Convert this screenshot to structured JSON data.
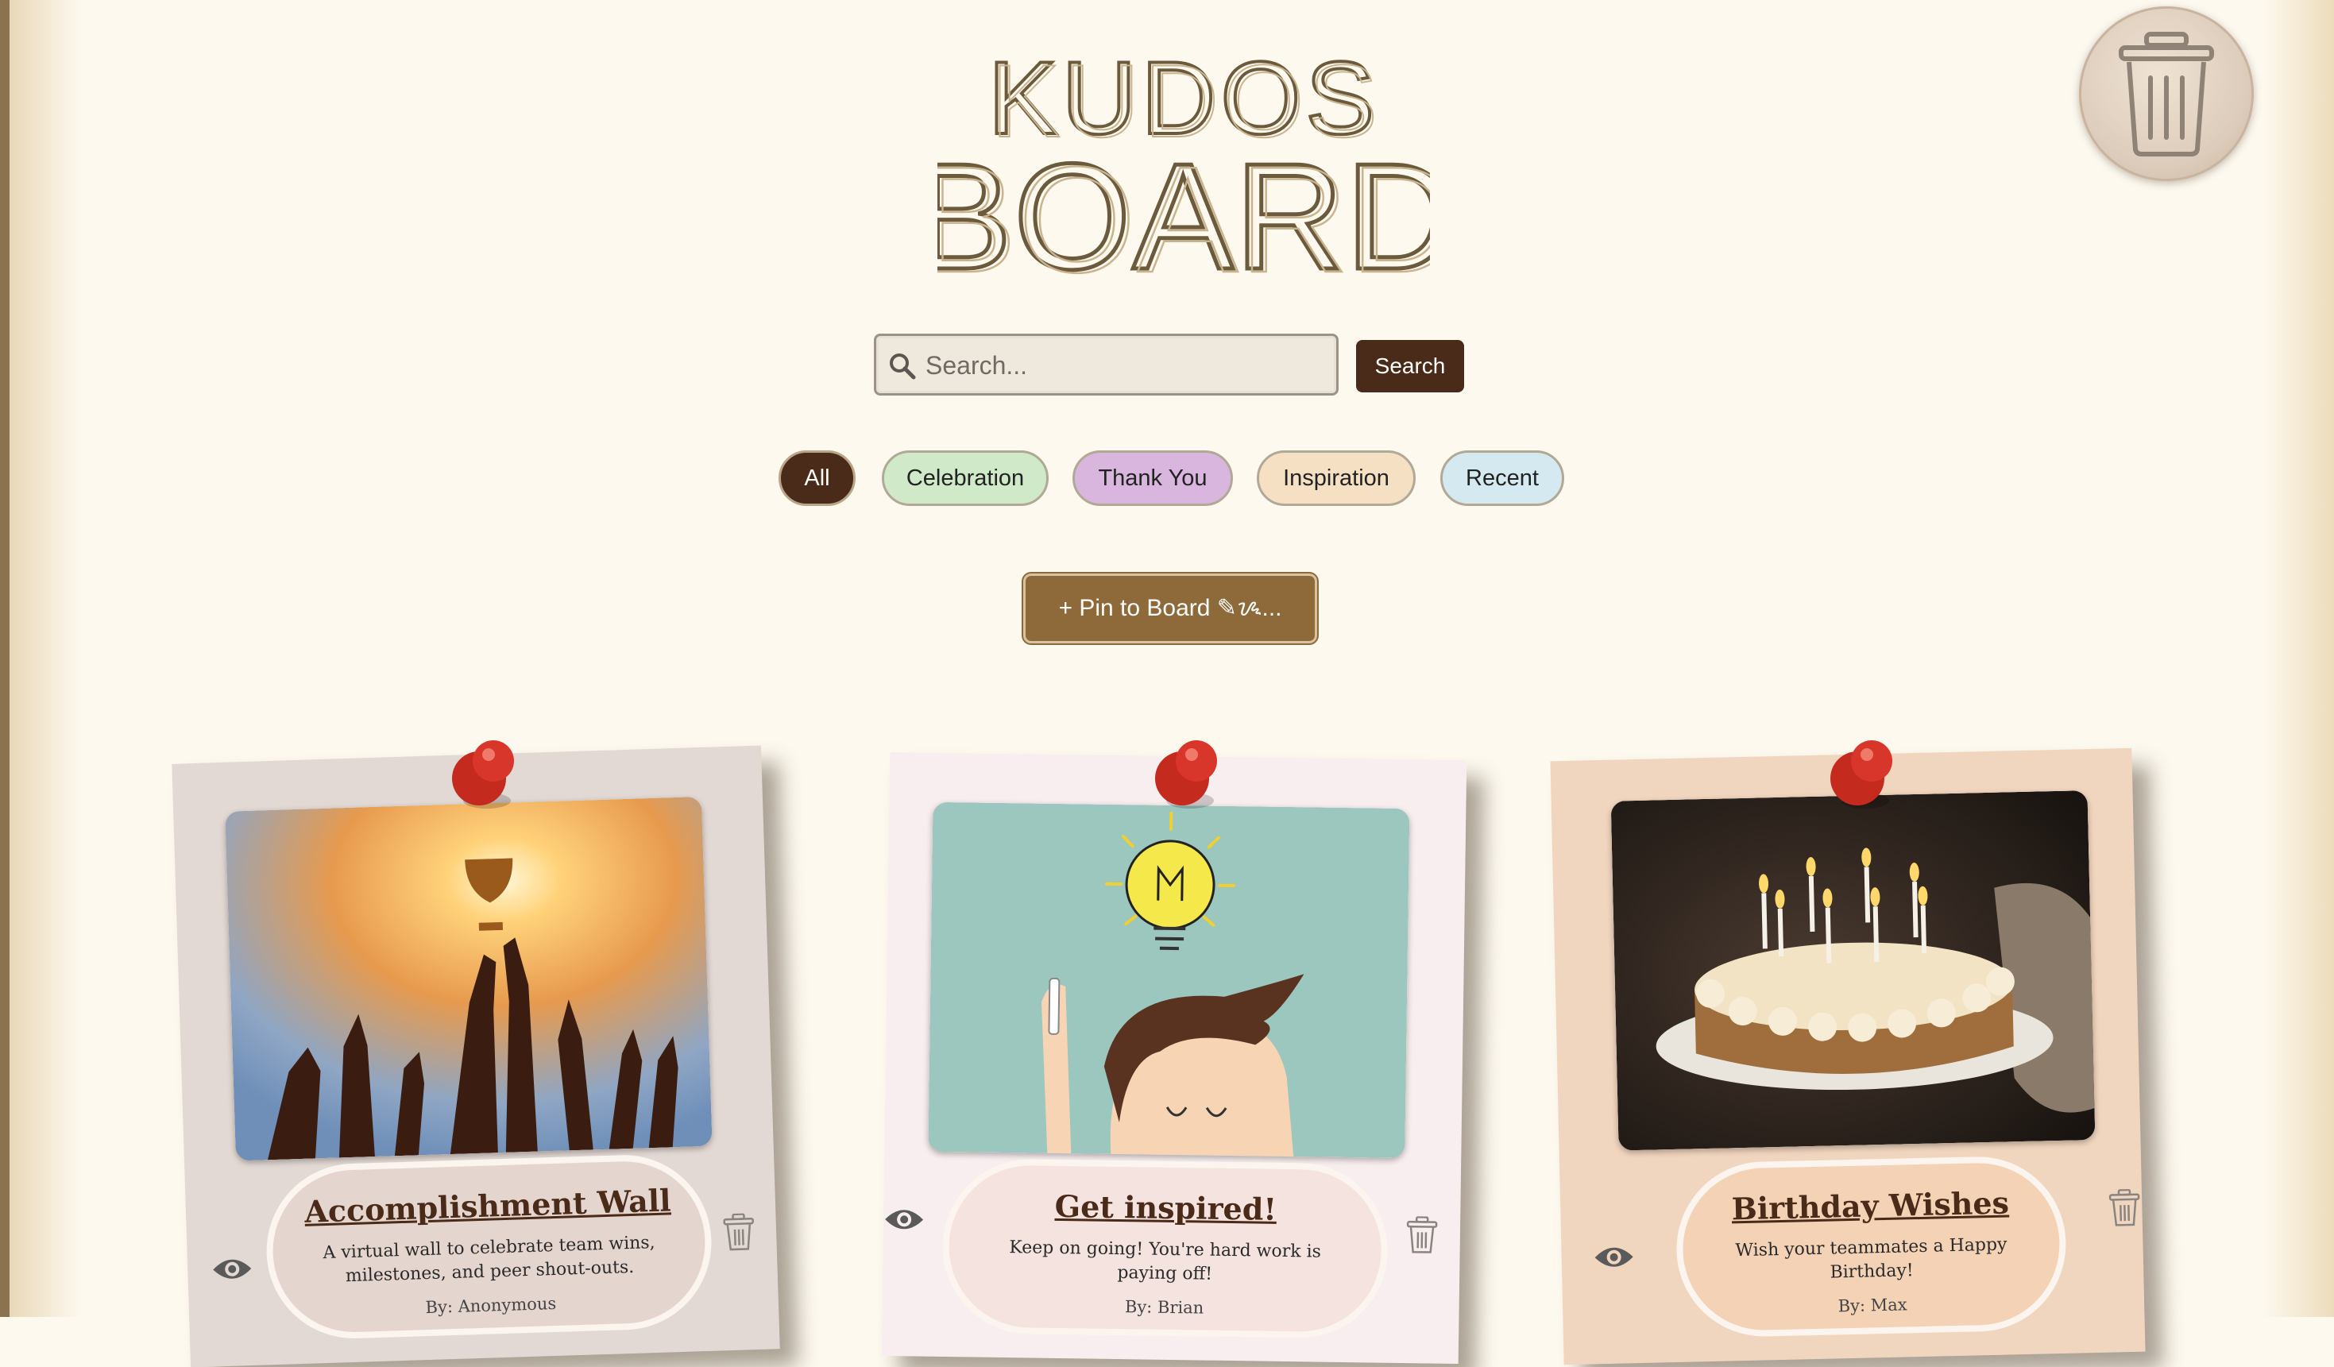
{
  "app": {
    "title_line1": "KUDOS",
    "title_line2": "BOARD"
  },
  "search": {
    "placeholder": "Search...",
    "button_label": "Search"
  },
  "filters": [
    {
      "label": "All",
      "active": true
    },
    {
      "label": "Celebration"
    },
    {
      "label": "Thank You"
    },
    {
      "label": "Inspiration"
    },
    {
      "label": "Recent"
    }
  ],
  "pin_button": {
    "label": "+ Pin to Board ✎ᝰ..."
  },
  "cards": [
    {
      "title": "Accomplishment Wall",
      "description": "A virtual wall to celebrate team wins, milestones, and peer shout-outs.",
      "author": "By: Anonymous",
      "image": "trophy-celebration-photo"
    },
    {
      "title": "Get inspired!",
      "description": "Keep on going! You're hard work is paying off!",
      "author": "By: Brian",
      "image": "lightbulb-idea-illustration"
    },
    {
      "title": "Birthday Wishes",
      "description": "Wish your teammates a Happy Birthday!",
      "author": "By: Max",
      "image": "birthday-cake-photo"
    }
  ],
  "colors": {
    "brand_dark": "#4a2a18",
    "pin_button": "#8e6a3a",
    "background": "#fdf9ef"
  },
  "icons": {
    "global_trash": "trash-icon",
    "search": "search-icon",
    "view": "eye-icon",
    "delete": "trash-icon"
  }
}
